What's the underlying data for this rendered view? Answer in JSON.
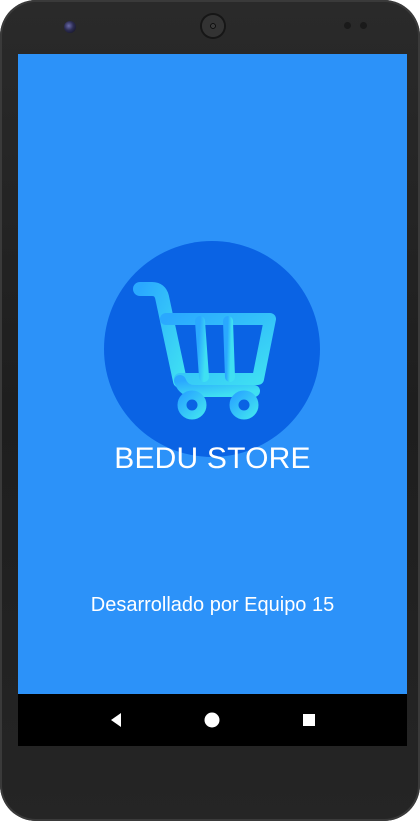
{
  "app": {
    "title": "BEDU STORE",
    "credits": "Desarrollado por Equipo 15"
  },
  "logo": {
    "icon": "shopping-cart-icon",
    "circle_color": "#0a63e4",
    "cart_color_start": "#2aa8ff",
    "cart_color_end": "#3fe0f2"
  },
  "theme": {
    "background": "#2c92f9",
    "text": "#ffffff"
  },
  "navigation_bar": {
    "back_icon": "back-triangle-icon",
    "home_icon": "home-circle-icon",
    "recents_icon": "recents-square-icon"
  }
}
